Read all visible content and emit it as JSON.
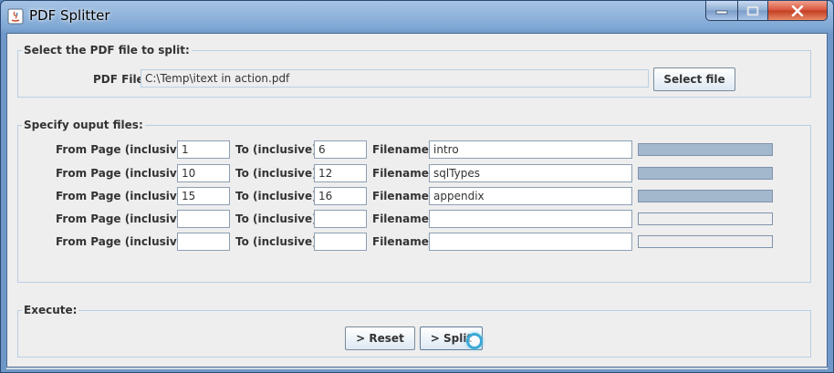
{
  "window": {
    "title": "PDF Splitter",
    "controls": {
      "minimize": "minimize",
      "maximize": "maximize",
      "close": "close"
    }
  },
  "select_section": {
    "legend": "Select the PDF file to split:",
    "pdf_file_label": "PDF File:",
    "pdf_file_value": "C:\\Temp\\itext in action.pdf",
    "select_button": "Select file"
  },
  "output_section": {
    "legend": "Specify ouput files:",
    "labels": {
      "from": "From Page (inclusive):",
      "to": "To (inclusive):",
      "filename": "Filename:"
    },
    "rows": [
      {
        "from": "1",
        "to": "6",
        "filename": "intro",
        "progress": 1.0
      },
      {
        "from": "10",
        "to": "12",
        "filename": "sqlTypes",
        "progress": 1.0
      },
      {
        "from": "15",
        "to": "16",
        "filename": "appendix",
        "progress": 1.0
      },
      {
        "from": "",
        "to": "",
        "filename": "",
        "progress": 0.0
      },
      {
        "from": "",
        "to": "",
        "filename": "",
        "progress": 0.0
      }
    ]
  },
  "execute_section": {
    "legend": "Execute:",
    "reset_button": "> Reset",
    "split_button": "> Split"
  },
  "colors": {
    "progress_fill": "#a3b8cc",
    "panel_border": "#b8cfe5",
    "window_frame": "#6f98c8",
    "close_button": "#c13d22",
    "busy_cursor": "#3aa9d6"
  }
}
